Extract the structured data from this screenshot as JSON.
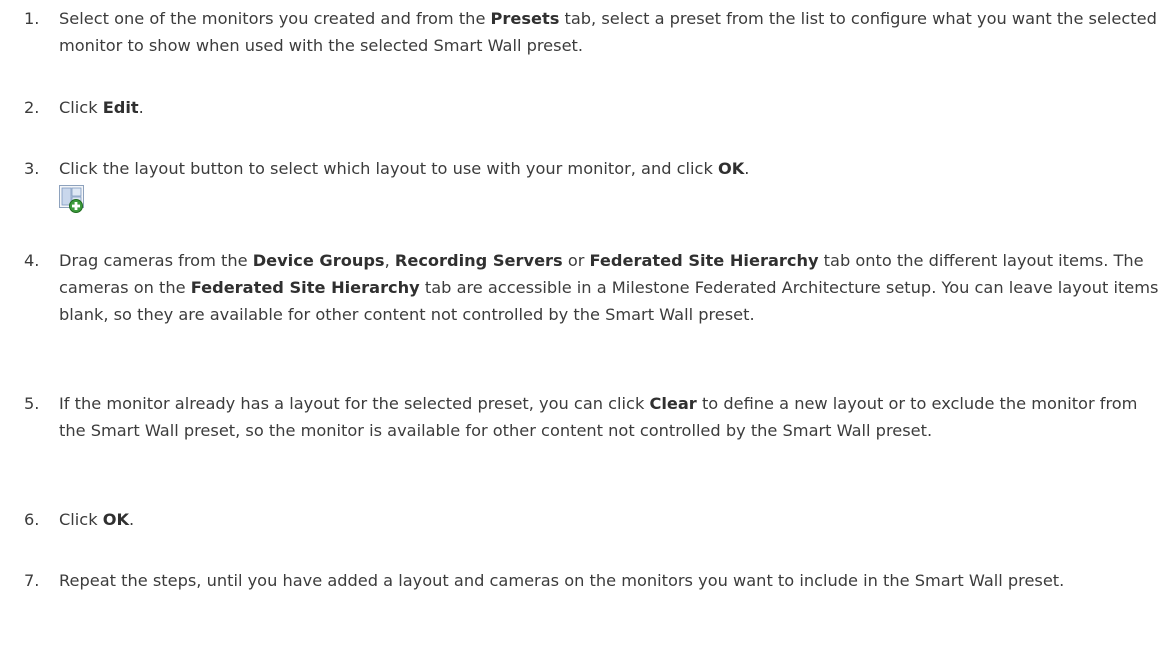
{
  "steps": [
    {
      "number": "1.",
      "segments": [
        {
          "text": "Select one of the monitors you created and from the ",
          "bold": false
        },
        {
          "text": "Presets",
          "bold": true
        },
        {
          "text": " tab, select a preset from the list to configure what you want the selected monitor to show when used with the selected Smart Wall preset.",
          "bold": false
        }
      ]
    },
    {
      "number": "2.",
      "segments": [
        {
          "text": "Click ",
          "bold": false
        },
        {
          "text": "Edit",
          "bold": true
        },
        {
          "text": ".",
          "bold": false
        }
      ]
    },
    {
      "number": "3.",
      "segments": [
        {
          "text": "Click the layout button to select which layout to use with your monitor, and click ",
          "bold": false
        },
        {
          "text": "OK",
          "bold": true
        },
        {
          "text": ".",
          "bold": false
        }
      ],
      "icon": "layout-add-icon"
    },
    {
      "number": "4.",
      "segments": [
        {
          "text": "Drag cameras from the ",
          "bold": false
        },
        {
          "text": "Device Groups",
          "bold": true
        },
        {
          "text": ", ",
          "bold": false
        },
        {
          "text": "Recording Servers",
          "bold": true
        },
        {
          "text": " or ",
          "bold": false
        },
        {
          "text": "Federated Site Hierarchy",
          "bold": true
        },
        {
          "text": " tab onto the different layout items. The cameras on the ",
          "bold": false
        },
        {
          "text": "Federated Site Hierarchy",
          "bold": true
        },
        {
          "text": " tab are accessible in a Milestone Federated Architecture setup. You can leave layout items blank, so they are available for other content not controlled by the Smart Wall preset.",
          "bold": false
        }
      ]
    },
    {
      "number": "5.",
      "segments": [
        {
          "text": "If the monitor already has a layout for the selected preset, you can click ",
          "bold": false
        },
        {
          "text": "Clear",
          "bold": true
        },
        {
          "text": " to define a new layout or to exclude the monitor from the Smart Wall preset, so the monitor is available for other content not controlled by the Smart Wall preset.",
          "bold": false
        }
      ]
    },
    {
      "number": "6.",
      "segments": [
        {
          "text": "Click ",
          "bold": false
        },
        {
          "text": "OK",
          "bold": true
        },
        {
          "text": ".",
          "bold": false
        }
      ]
    },
    {
      "number": "7.",
      "segments": [
        {
          "text": "Repeat the steps, until you have added a layout and cameras on the monitors you want to include in the Smart Wall preset.",
          "bold": false
        }
      ]
    }
  ]
}
